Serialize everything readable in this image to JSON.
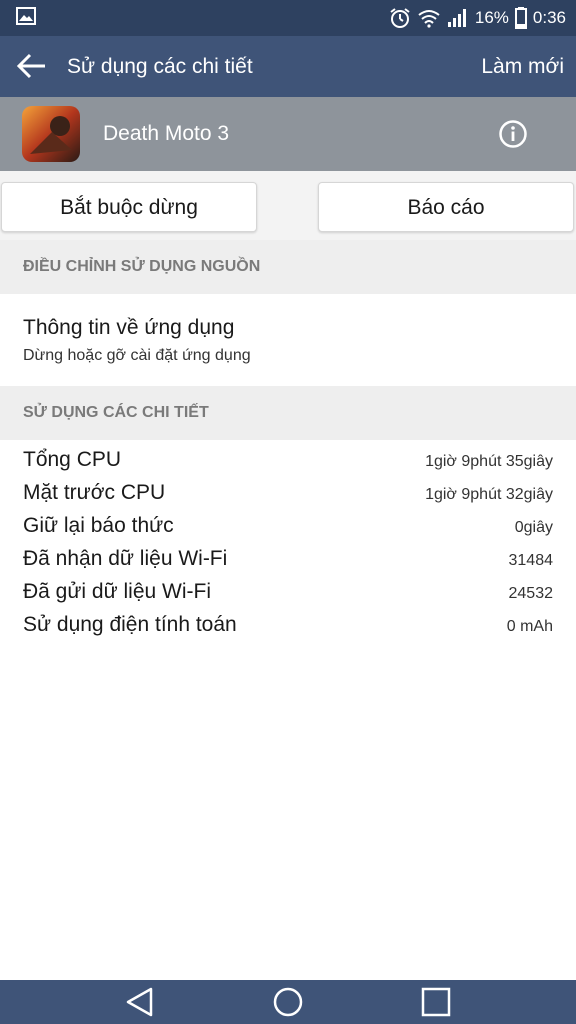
{
  "status_bar": {
    "battery_percent": "16%",
    "time": "0:36",
    "icons": [
      "gallery-icon",
      "alarm-icon",
      "wifi-icon",
      "signal-icon",
      "battery-icon"
    ]
  },
  "app_bar": {
    "title": "Sử dụng các chi tiết",
    "refresh_label": "Làm mới",
    "back_icon": "arrow-left-icon"
  },
  "app": {
    "name": "Death Moto 3",
    "info_icon": "info-icon"
  },
  "actions": {
    "force_stop_label": "Bắt buộc dừng",
    "report_label": "Báo cáo"
  },
  "power_section": {
    "header": "ĐIỀU CHỈNH SỬ DỤNG NGUỒN",
    "app_info_title": "Thông tin về ứng dụng",
    "app_info_subtitle": "Dừng hoặc gỡ cài đặt ứng dụng"
  },
  "details_section": {
    "header": "SỬ DỤNG CÁC CHI TIẾT",
    "rows": [
      {
        "label": "Tổng CPU",
        "value": "1giờ 9phút 35giây"
      },
      {
        "label": "Mặt trước CPU",
        "value": "1giờ 9phút 32giây"
      },
      {
        "label": "Giữ lại báo thức",
        "value": "0giây"
      },
      {
        "label": "Đã nhận dữ liệu Wi-Fi",
        "value": "31484"
      },
      {
        "label": "Đã gửi dữ liệu Wi-Fi",
        "value": "24532"
      },
      {
        "label": "Sử dụng điện tính toán",
        "value": "0 mAh"
      }
    ]
  },
  "nav_bar": {
    "icons": [
      "back-triangle-icon",
      "home-circle-icon",
      "recents-square-icon"
    ]
  },
  "colors": {
    "status_bar": "#2e4160",
    "app_bar": "#3f5478",
    "app_header": "#8e949b",
    "section_bg": "#eeeeee"
  }
}
